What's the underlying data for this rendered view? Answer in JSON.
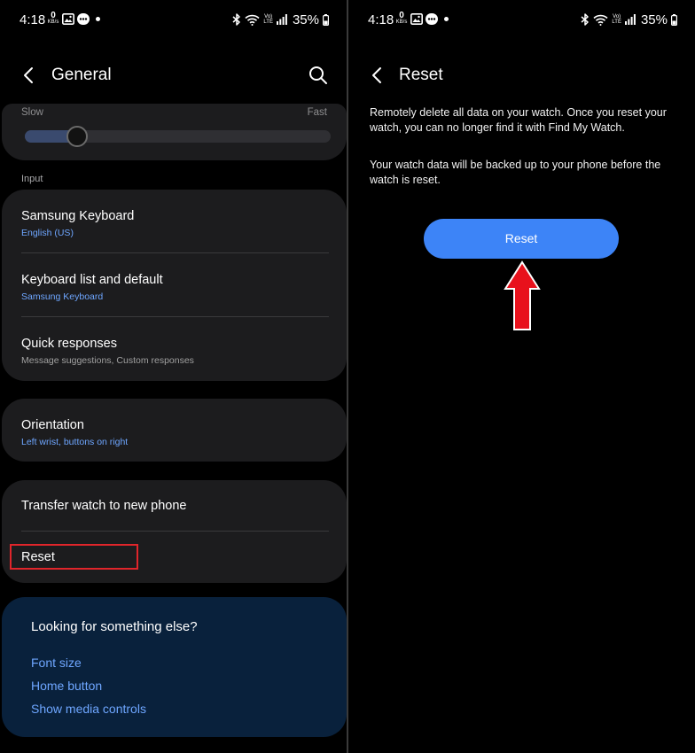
{
  "status_bar": {
    "time": "4:18",
    "kbs_value": "0",
    "kbs_unit": "KB/s",
    "volte_top": "Vo)",
    "volte_bottom": "LTE",
    "battery": "35%"
  },
  "left": {
    "header": {
      "title": "General",
      "back_icon": "back-chevron-icon",
      "search_icon": "search-icon"
    },
    "speed_slider": {
      "min_label": "Slow",
      "max_label": "Fast",
      "value": 0.17
    },
    "input_section": {
      "label": "Input",
      "items": [
        {
          "title": "Samsung Keyboard",
          "subtitle": "English (US)"
        },
        {
          "title": "Keyboard list and default",
          "subtitle": "Samsung Keyboard"
        },
        {
          "title": "Quick responses",
          "subtitle": "Message suggestions, Custom responses"
        }
      ]
    },
    "orientation": {
      "title": "Orientation",
      "subtitle": "Left wrist, buttons on right"
    },
    "transfer": {
      "title": "Transfer watch to new phone"
    },
    "reset": {
      "title": "Reset"
    },
    "help": {
      "title": "Looking for something else?",
      "links": [
        "Font size",
        "Home button",
        "Show media controls"
      ]
    }
  },
  "right": {
    "header": {
      "title": "Reset",
      "back_icon": "back-chevron-icon"
    },
    "paragraph1": "Remotely delete all data on your watch. Once you reset your watch, you can no longer find it with Find My Watch.",
    "paragraph2": "Your watch data will be backed up to your phone before the watch is reset.",
    "reset_button": "Reset"
  },
  "colors": {
    "accent": "#3d84f7",
    "link": "#6ea6ff",
    "card": "#1c1c1e",
    "help_card": "#09213c",
    "highlight": "#e0252b",
    "arrow": "#e8111c"
  }
}
